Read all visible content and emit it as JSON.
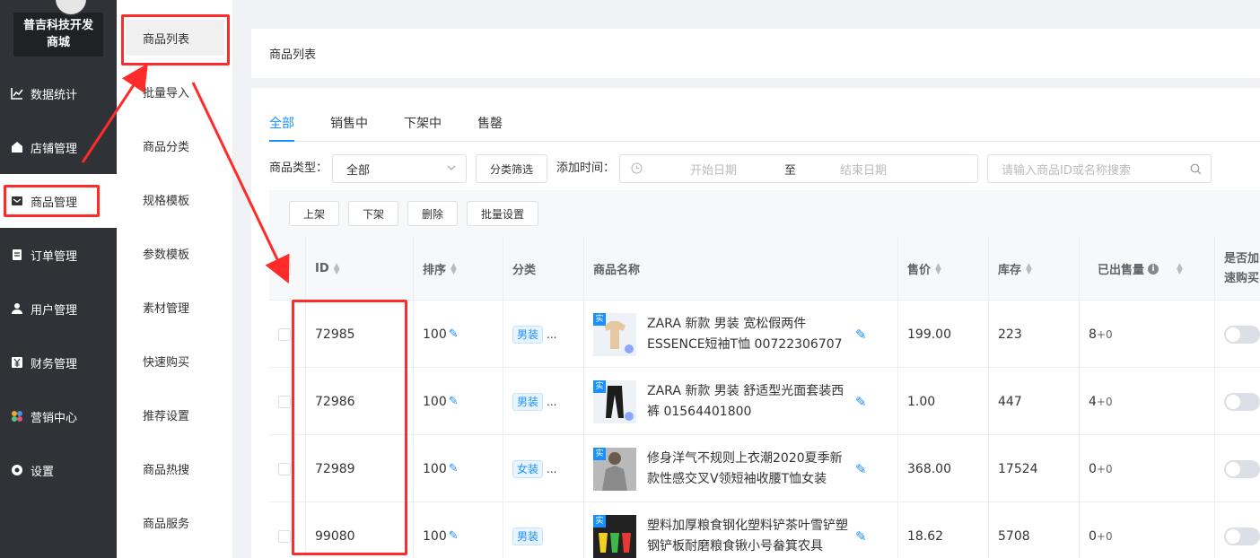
{
  "sidebar": {
    "brand_line1": "普吉科技开发",
    "brand_line2": "商城",
    "items": [
      {
        "label": "数据统计",
        "icon": "chart-line-icon"
      },
      {
        "label": "店铺管理",
        "icon": "store-icon"
      },
      {
        "label": "商品管理",
        "icon": "goods-icon"
      },
      {
        "label": "订单管理",
        "icon": "order-icon"
      },
      {
        "label": "用户管理",
        "icon": "user-icon"
      },
      {
        "label": "财务管理",
        "icon": "finance-icon"
      },
      {
        "label": "营销中心",
        "icon": "marketing-icon"
      },
      {
        "label": "设置",
        "icon": "settings-icon"
      }
    ]
  },
  "submenu": {
    "items": [
      "商品列表",
      "批量导入",
      "商品分类",
      "规格模板",
      "参数模板",
      "素材管理",
      "快速购买",
      "推荐设置",
      "商品热搜",
      "商品服务"
    ]
  },
  "breadcrumb": "商品列表",
  "tabs": [
    "全部",
    "销售中",
    "下架中",
    "售罄"
  ],
  "filter": {
    "type_label": "商品类型：",
    "type_value": "全部",
    "category_btn": "分类筛选",
    "time_label": "添加时间：",
    "start_placeholder": "开始日期",
    "to": "至",
    "end_placeholder": "结束日期",
    "search_placeholder": "请输入商品ID或名称搜索"
  },
  "actions": [
    "上架",
    "下架",
    "删除",
    "批量设置"
  ],
  "table": {
    "headers": {
      "id": "ID",
      "sort": "排序",
      "category": "分类",
      "name": "商品名称",
      "price": "售价",
      "stock": "库存",
      "sold": "已出售量",
      "quick_buy_1": "是否加",
      "quick_buy_2": "速购买"
    },
    "rows": [
      {
        "id": "72985",
        "sort": "100",
        "category": "男装",
        "more": "...",
        "badge": "实",
        "name": "ZARA 新款 男装 宽松假两件 ESSENCE短袖T恤 00722306707",
        "price": "199.00",
        "stock": "223",
        "sold": "8",
        "sold_extra": "+0"
      },
      {
        "id": "72986",
        "sort": "100",
        "category": "男装",
        "more": "...",
        "badge": "实",
        "name": "ZARA 新款 男装 舒适型光面套装西裤 01564401800",
        "price": "1.00",
        "stock": "447",
        "sold": "4",
        "sold_extra": "+0"
      },
      {
        "id": "72989",
        "sort": "100",
        "category": "女装",
        "more": "...",
        "badge": "实",
        "name": "修身洋气不规则上衣潮2020夏季新款性感交叉V领短袖收腰T恤女装",
        "price": "368.00",
        "stock": "17524",
        "sold": "0",
        "sold_extra": "+0"
      },
      {
        "id": "99080",
        "sort": "100",
        "category": "男装",
        "more": "",
        "badge": "实",
        "name": "塑料加厚粮食钢化塑料铲茶叶雪铲塑钢铲板耐磨粮食锹小号畚箕农具",
        "price": "18.62",
        "stock": "5708",
        "sold": "0",
        "sold_extra": "+0"
      }
    ]
  },
  "colors": {
    "accent": "#1890ff",
    "sidebar": "#2f3237",
    "annotation": "#ff2b2b"
  }
}
